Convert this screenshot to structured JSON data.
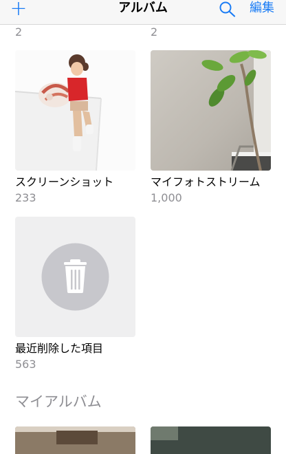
{
  "nav": {
    "add_icon": "plus-icon",
    "title": "アルバム",
    "search_icon": "search-icon",
    "edit_label": "編集",
    "accent_color": "#1a7cf5"
  },
  "top_row_counts": [
    "2",
    "2"
  ],
  "albums": [
    {
      "name": "スクリーンショット",
      "count": "233",
      "thumb": "figurine-on-cup"
    },
    {
      "name": "マイフォトストリーム",
      "count": "1,000",
      "thumb": "plant-by-window"
    },
    {
      "name": "最近削除した項目",
      "count": "563",
      "thumb": "trash-icon"
    }
  ],
  "section": {
    "title": "マイアルバム"
  }
}
